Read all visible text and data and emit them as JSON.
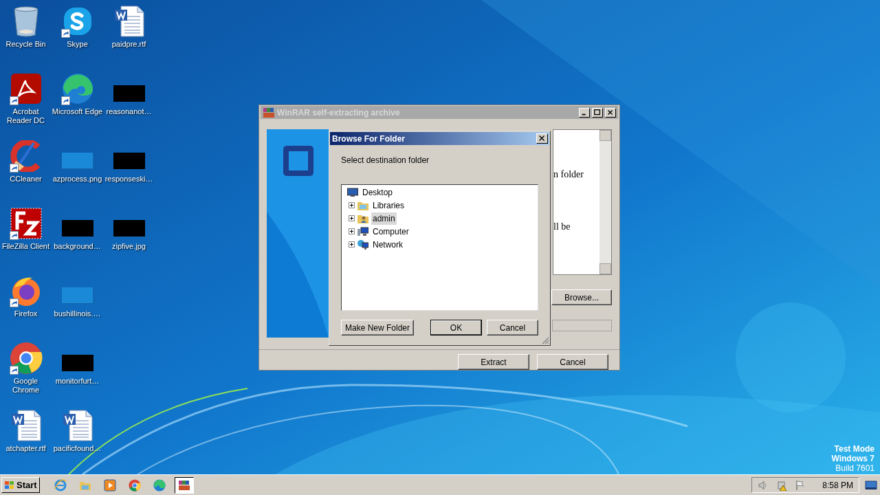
{
  "desktop": {
    "columns": [
      [
        {
          "label": "Recycle Bin",
          "kind": "bin",
          "shortcut": false
        },
        {
          "label": "Acrobat Reader DC",
          "kind": "acrobat",
          "shortcut": true
        },
        {
          "label": "CCleaner",
          "kind": "ccleaner",
          "shortcut": true
        },
        {
          "label": "FileZilla Client",
          "kind": "filezilla",
          "shortcut": true
        },
        {
          "label": "Firefox",
          "kind": "firefox",
          "shortcut": true
        },
        {
          "label": "Google Chrome",
          "kind": "chrome",
          "shortcut": true
        },
        {
          "label": "atchapter.rtf",
          "kind": "document",
          "shortcut": false
        }
      ],
      [
        {
          "label": "Skype",
          "kind": "skype",
          "shortcut": true
        },
        {
          "label": "Microsoft Edge",
          "kind": "edge",
          "shortcut": true
        },
        {
          "label": "azprocess.png",
          "kind": "blank-thumb",
          "shortcut": false
        },
        {
          "label": "background…",
          "kind": "dark-thumb",
          "shortcut": false
        },
        {
          "label": "bushillinois.…",
          "kind": "blank-thumb",
          "shortcut": false
        },
        {
          "label": "monitorfurt…",
          "kind": "dark-thumb",
          "shortcut": false
        },
        {
          "label": "pacificfound…",
          "kind": "document",
          "shortcut": false
        }
      ],
      [
        {
          "label": "paidpre.rtf",
          "kind": "document",
          "shortcut": false
        },
        {
          "label": "reasonanot…",
          "kind": "dark-thumb",
          "shortcut": false
        },
        {
          "label": "responseski…",
          "kind": "dark-thumb",
          "shortcut": false
        },
        {
          "label": "zipfive.jpg",
          "kind": "dark-thumb",
          "shortcut": false
        }
      ]
    ]
  },
  "os_notice": [
    "Test Mode",
    "Windows 7",
    "Build 7601"
  ],
  "winrar": {
    "title": "WinRAR self-extracting archive",
    "text_fragments": [
      "n folder",
      "ll be"
    ],
    "browse_button": "Browse...",
    "progress": {
      "level": 0
    },
    "buttons": [
      "Extract",
      "Cancel"
    ]
  },
  "browse_dialog": {
    "title": "Browse For Folder",
    "prompt": "Select destination folder",
    "tree": [
      {
        "label": "Desktop",
        "kind": "desktop",
        "selected": false,
        "children": [
          {
            "label": "Libraries",
            "kind": "libraries",
            "expanded": false,
            "selected": false
          },
          {
            "label": "admin",
            "kind": "user",
            "expanded": false,
            "selected": true
          },
          {
            "label": "Computer",
            "kind": "computer",
            "expanded": false,
            "selected": false
          },
          {
            "label": "Network",
            "kind": "network",
            "expanded": false,
            "selected": false
          }
        ]
      }
    ],
    "buttons": [
      {
        "label": "Make New Folder",
        "default": false
      },
      {
        "label": "OK",
        "default": true
      },
      {
        "label": "Cancel",
        "default": false
      }
    ]
  },
  "taskbar": {
    "start": "Start",
    "apps": [
      {
        "kind": "ie",
        "active": false
      },
      {
        "kind": "explorer",
        "active": false
      },
      {
        "kind": "media",
        "active": false
      },
      {
        "kind": "chrome",
        "active": false
      },
      {
        "kind": "edge",
        "active": false
      },
      {
        "kind": "winrar",
        "active": true
      }
    ],
    "clock": "8:58 PM"
  }
}
